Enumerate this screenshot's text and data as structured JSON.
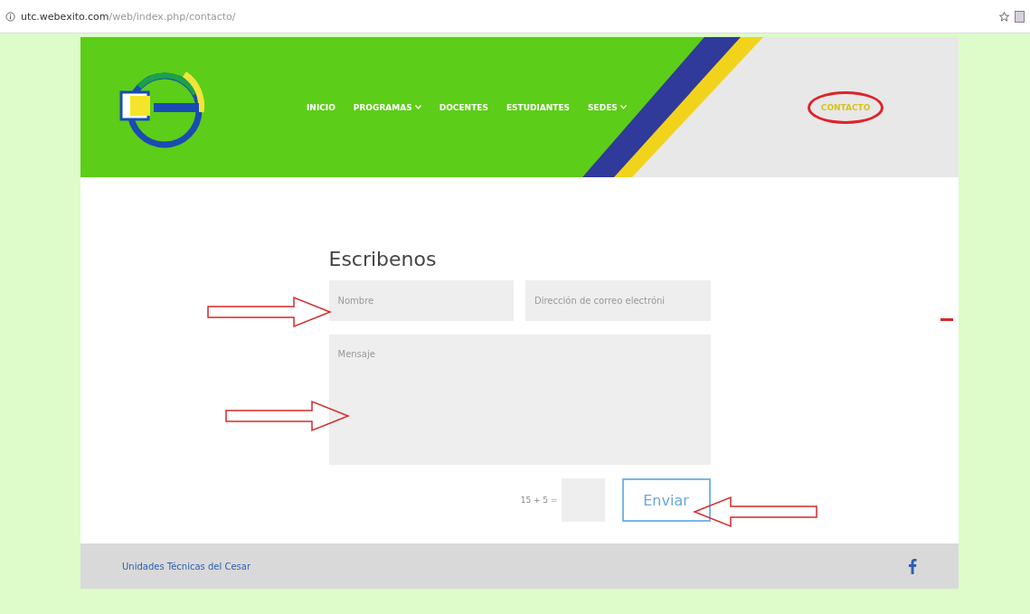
{
  "address_bar": {
    "host": "utc.webexito.com",
    "path": "/web/index.php/contacto/"
  },
  "nav": [
    {
      "label": "INICIO",
      "dropdown": false,
      "selected": false
    },
    {
      "label": "PROGRAMAS",
      "dropdown": true,
      "selected": false
    },
    {
      "label": "DOCENTES",
      "dropdown": false,
      "selected": false
    },
    {
      "label": "ESTUDIANTES",
      "dropdown": false,
      "selected": false
    },
    {
      "label": "SEDES",
      "dropdown": true,
      "selected": false
    },
    {
      "label": "CONTACTO",
      "dropdown": false,
      "selected": true
    }
  ],
  "form": {
    "title": "Escribenos",
    "name_placeholder": "Nombre",
    "email_placeholder": "Dirección de correo electróni",
    "message_placeholder": "Mensaje",
    "captcha": "15 + 5 =",
    "submit": "Enviar"
  },
  "footer": {
    "text": "Unidades Técnicas del Cesar"
  }
}
